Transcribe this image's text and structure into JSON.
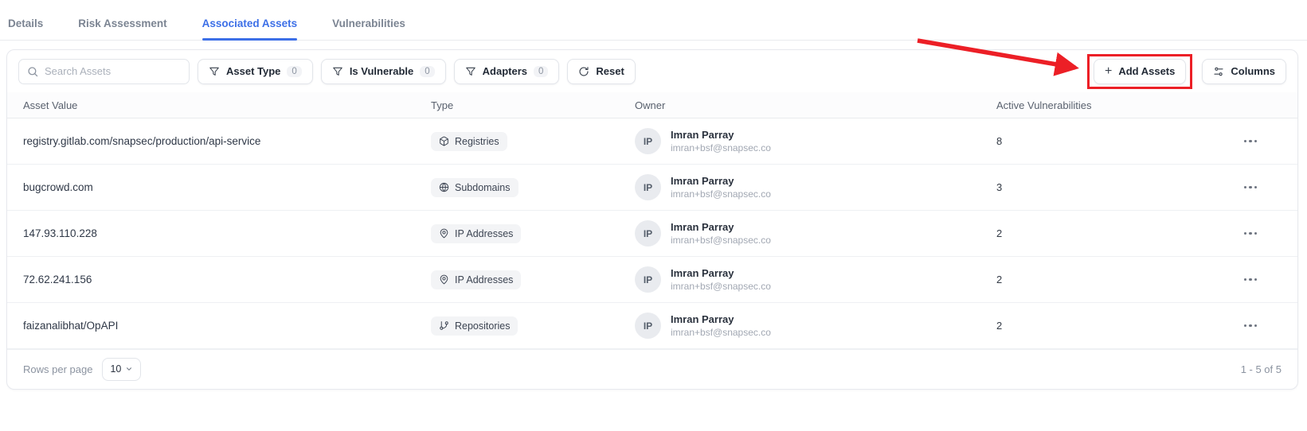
{
  "tabs": [
    {
      "label": "Details",
      "active": false
    },
    {
      "label": "Risk Assessment",
      "active": false
    },
    {
      "label": "Associated Assets",
      "active": true
    },
    {
      "label": "Vulnerabilities",
      "active": false
    }
  ],
  "toolbar": {
    "search_placeholder": "Search Assets",
    "filters": [
      {
        "label": "Asset Type",
        "count": "0"
      },
      {
        "label": "Is Vulnerable",
        "count": "0"
      },
      {
        "label": "Adapters",
        "count": "0"
      }
    ],
    "reset_label": "Reset",
    "add_assets_label": "Add Assets",
    "columns_label": "Columns"
  },
  "table": {
    "headers": {
      "asset": "Asset Value",
      "type": "Type",
      "owner": "Owner",
      "vulns": "Active Vulnerabilities"
    },
    "rows": [
      {
        "asset": "registry.gitlab.com/snapsec/production/api-service",
        "type": "Registries",
        "type_icon": "package-icon",
        "owner_initials": "IP",
        "owner_name": "Imran Parray",
        "owner_email": "imran+bsf@snapsec.co",
        "vulns": "8"
      },
      {
        "asset": "bugcrowd.com",
        "type": "Subdomains",
        "type_icon": "globe-icon",
        "owner_initials": "IP",
        "owner_name": "Imran Parray",
        "owner_email": "imran+bsf@snapsec.co",
        "vulns": "3"
      },
      {
        "asset": "147.93.110.228",
        "type": "IP Addresses",
        "type_icon": "map-pin-icon",
        "owner_initials": "IP",
        "owner_name": "Imran Parray",
        "owner_email": "imran+bsf@snapsec.co",
        "vulns": "2"
      },
      {
        "asset": "72.62.241.156",
        "type": "IP Addresses",
        "type_icon": "map-pin-icon",
        "owner_initials": "IP",
        "owner_name": "Imran Parray",
        "owner_email": "imran+bsf@snapsec.co",
        "vulns": "2"
      },
      {
        "asset": "faizanalibhat/OpAPI",
        "type": "Repositories",
        "type_icon": "git-branch-icon",
        "owner_initials": "IP",
        "owner_name": "Imran Parray",
        "owner_email": "imran+bsf@snapsec.co",
        "vulns": "2"
      }
    ]
  },
  "pagination": {
    "rows_per_page_label": "Rows per page",
    "page_size": "10",
    "range": "1 - 5 of 5"
  },
  "annotation": {
    "target": "Add Assets button",
    "shape": "red arrow and red rectangle highlight"
  },
  "colors": {
    "accent_blue": "#3c6fe7",
    "highlight_red": "#ec1f26"
  }
}
